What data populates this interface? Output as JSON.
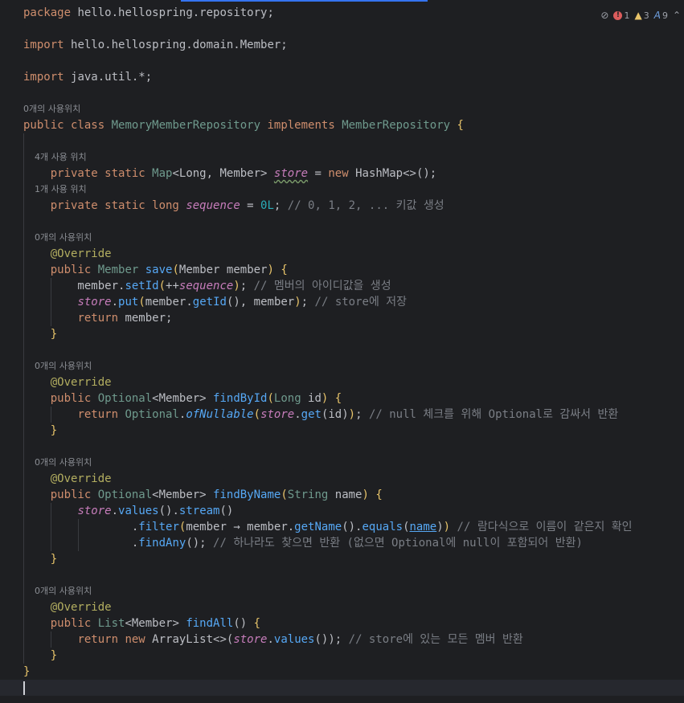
{
  "inspection": {
    "errors": "1",
    "warnings": "3",
    "typos": "9"
  },
  "code": {
    "package_kw": "package",
    "package_name": "hello.hellospring.repository;",
    "import_kw": "import",
    "import_1": "hello.hellospring.domain.Member;",
    "import_2": "java.util.*;",
    "usage_0": "0개의 사용위치",
    "usage_4": "4개 사용 위치",
    "usage_1": "1개 사용 위치",
    "comment_seq": "// 0, 1, 2, ... 키값 생성",
    "comment_setid": "// 멤버의 아이디값을 생성",
    "comment_put": "// store에 저장",
    "comment_findbyid": "// null 체크를 위해 Optional로 감싸서 반환",
    "comment_filter": "// 람다식으로 이름이 같은지 확인",
    "comment_findany": "// 하나라도 찾으면 반환 (없으면 Optional에 null이 포함되어 반환)",
    "comment_findall": "// store에 있는 모든 멤버 반환"
  }
}
